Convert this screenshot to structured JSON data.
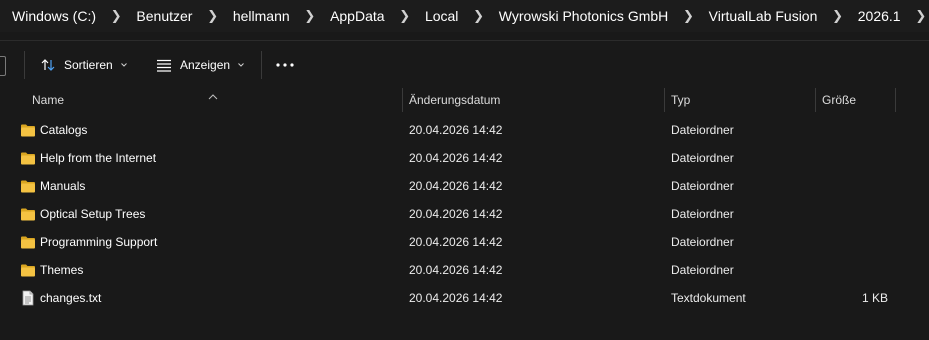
{
  "breadcrumb": {
    "segments": [
      "Windows (C:)",
      "Benutzer",
      "hellmann",
      "AppData",
      "Local",
      "Wyrowski Photonics GmbH",
      "VirtualLab Fusion",
      "2026.1"
    ],
    "separator_icon": "chevron-right-icon"
  },
  "toolbar": {
    "sort_label": "Sortieren",
    "sort_icon": "sort-arrows-icon",
    "view_label": "Anzeigen",
    "view_icon": "view-lines-icon",
    "more_icon": "more-ellipsis-icon",
    "dropdown_icon": "chevron-down-icon"
  },
  "columns": {
    "name": "Name",
    "date": "Änderungsdatum",
    "type": "Typ",
    "size": "Größe"
  },
  "files": [
    {
      "name": "Catalogs",
      "date": "20.04.2026 14:42",
      "type": "Dateiordner",
      "size": "",
      "icon": "folder-icon"
    },
    {
      "name": "Help from the Internet",
      "date": "20.04.2026 14:42",
      "type": "Dateiordner",
      "size": "",
      "icon": "folder-icon"
    },
    {
      "name": "Manuals",
      "date": "20.04.2026 14:42",
      "type": "Dateiordner",
      "size": "",
      "icon": "folder-icon"
    },
    {
      "name": "Optical Setup Trees",
      "date": "20.04.2026 14:42",
      "type": "Dateiordner",
      "size": "",
      "icon": "folder-icon"
    },
    {
      "name": "Programming Support",
      "date": "20.04.2026 14:42",
      "type": "Dateiordner",
      "size": "",
      "icon": "folder-icon"
    },
    {
      "name": "Themes",
      "date": "20.04.2026 14:42",
      "type": "Dateiordner",
      "size": "",
      "icon": "folder-icon"
    },
    {
      "name": "changes.txt",
      "date": "20.04.2026 14:42",
      "type": "Textdokument",
      "size": "1 KB",
      "icon": "text-file-icon"
    }
  ],
  "colors": {
    "background": "#191919",
    "folder_yellow": "#f4c242",
    "folder_back": "#d9a521",
    "text": "#ffffff"
  }
}
